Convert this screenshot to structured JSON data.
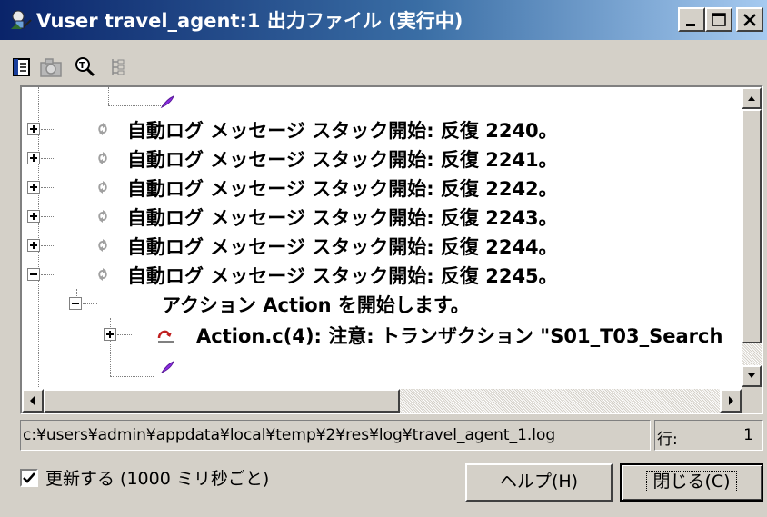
{
  "window": {
    "title": "Vuser travel_agent:1 出力ファイル (実行中)"
  },
  "toolbar": {
    "items": [
      "log-view-icon",
      "camera-icon",
      "find-text-icon",
      "tree-view-icon"
    ]
  },
  "log": {
    "rows": [
      {
        "text": "自動ログ メッセージ スタック開始: 反復 2240。",
        "expander": "plus"
      },
      {
        "text": "自動ログ メッセージ スタック開始: 反復 2241。",
        "expander": "plus"
      },
      {
        "text": "自動ログ メッセージ スタック開始: 反復 2242。",
        "expander": "plus"
      },
      {
        "text": "自動ログ メッセージ スタック開始: 反復 2243。",
        "expander": "plus"
      },
      {
        "text": "自動ログ メッセージ スタック開始: 反復 2244。",
        "expander": "plus"
      },
      {
        "text": "自動ログ メッセージ スタック開始: 反復 2245。",
        "expander": "minus"
      }
    ],
    "action_row": "アクション Action を開始します。",
    "warning_row": "Action.c(4): 注意: トランザクション \"S01_T03_Search"
  },
  "status": {
    "path": "c:¥users¥admin¥appdata¥local¥temp¥2¥res¥log¥travel_agent_1.log",
    "line_label": "行:",
    "line_value": "1"
  },
  "footer": {
    "refresh_label": "更新する (1000 ミリ秒ごと)",
    "refresh_checked": true,
    "help_button": "ヘルプ(H)",
    "close_button": "閉じる(C)"
  }
}
